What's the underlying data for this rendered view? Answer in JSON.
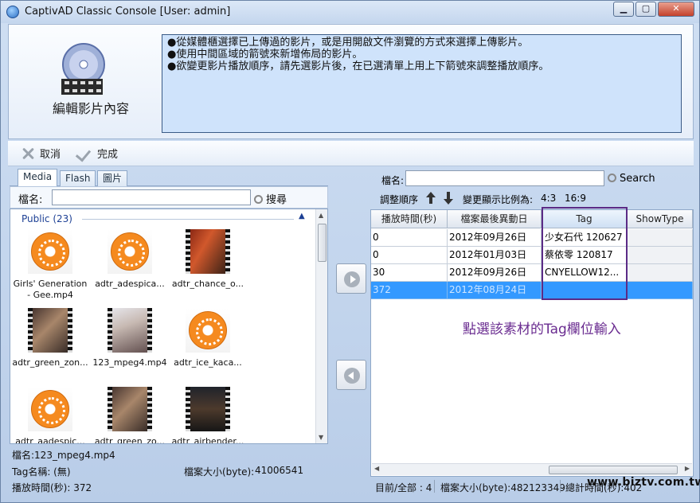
{
  "window": {
    "title": "CaptivAD Classic Console [User: admin]",
    "min": "▁",
    "max": "▢",
    "close": "✕"
  },
  "header": {
    "title": "編輯影片內容",
    "instructions": [
      "●從媒體櫃選擇已上傳過的影片，或是用開啟文件瀏覽的方式來選擇上傳影片。",
      "●使用中間區域的箭號來新增佈局的影片。",
      "●欲變更影片播放順序，請先選影片後，在已選清單上用上下箭號來調整播放順序。"
    ]
  },
  "toolbar": {
    "cancel": "取消",
    "done": "完成"
  },
  "left": {
    "tabs": [
      "Media",
      "Flash",
      "圖片"
    ],
    "filename_label": "檔名:",
    "search_label": "搜尋",
    "group": "Public (23)",
    "items": [
      {
        "name": "Girls' Generation - Gee.mp4",
        "icon": "video-file-icon"
      },
      {
        "name": "adtr_adespica...",
        "icon": "video-file-icon"
      },
      {
        "name": "adtr_chance_o...",
        "icon": "video-thumbnail"
      },
      {
        "name": "adtr_green_zon...",
        "icon": "video-thumbnail"
      },
      {
        "name": "123_mpeg4.mp4",
        "icon": "video-thumbnail"
      },
      {
        "name": "adtr_ice_kaca...",
        "icon": "video-file-icon"
      },
      {
        "name": "adtr_aadespic...",
        "icon": "video-file-icon"
      },
      {
        "name": "adtr_green_zo...",
        "icon": "video-thumbnail"
      },
      {
        "name": "adtr_airbender...",
        "icon": "video-thumbnail"
      }
    ],
    "info": {
      "filename": "檔名:123_mpeg4.mp4",
      "tagname": "Tag名稱: (無)",
      "filesize_label": "檔案大小(byte):",
      "filesize": "41006541",
      "duration": "播放時間(秒): 372"
    }
  },
  "right": {
    "filename_label": "檔名:",
    "search_label": "Search",
    "order_label": "調整順序",
    "ratio_label": "變更顯示比例為:",
    "ratio_43": "4:3",
    "ratio_169": "16:9",
    "columns": [
      "播放時間(秒)",
      "檔案最後異動日",
      "Tag",
      "ShowType"
    ],
    "rows": [
      {
        "duration": "0",
        "modified": "2012年09月26日",
        "tag": "少女石代 120627",
        "showtype": ""
      },
      {
        "duration": "0",
        "modified": "2012年01月03日",
        "tag": "蔡依零 120817",
        "showtype": ""
      },
      {
        "duration": "30",
        "modified": "2012年09月26日",
        "tag": "CNYELLOW12...",
        "showtype": ""
      },
      {
        "duration": "372",
        "modified": "2012年08月24日",
        "tag": "",
        "showtype": ""
      }
    ],
    "note": "點選該素材的Tag欄位輸入",
    "status": {
      "count": "目前/全部 : 4",
      "size": "檔案大小(byte):482123349",
      "time": "總計時間(秒):402"
    }
  },
  "watermark": "www.biztv.com.tw",
  "colors": {
    "selected_row": "#3399ff",
    "annotation": "#6a2c90"
  }
}
